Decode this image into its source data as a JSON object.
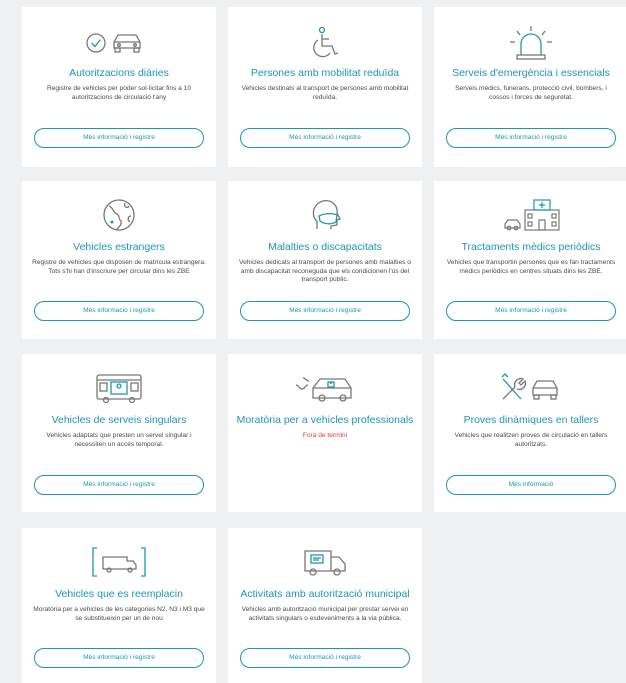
{
  "colors": {
    "accent": "#1c96b3",
    "text": "#4a4a4a",
    "alert": "#e53935",
    "background": "#eef0f2",
    "card": "#ffffff"
  },
  "cards": [
    {
      "icon": "check-car-icon",
      "title": "Autoritzacions diàries",
      "description": "Registre de vehicles per poder sol·licitar fins a 10 autoritzacions de circulació l'any",
      "button": "Més informació i registre"
    },
    {
      "icon": "wheelchair-icon",
      "title": "Persones amb mobilitat reduïda",
      "description": "Vehicles destinats al transport de persones amb mobilitat reduïda.",
      "button": "Més informació i registre"
    },
    {
      "icon": "emergency-siren-icon",
      "title": "Serveis d'emergència i essencials",
      "description": "Serveis mèdics, funeraris, protecció civil, bombers, i cossos i forces de seguretat.",
      "button": "Més informació i registre"
    },
    {
      "icon": "globe-icon",
      "title": "Vehicles estrangers",
      "description": "Registre de vehicles que disposen de matrícula estrangera. Tots s'hi han d'inscriure per circular dins les ZBE",
      "button": "Més informació i registre"
    },
    {
      "icon": "masked-head-icon",
      "title": "Malalties o discapacitats",
      "description": "Vehicles dedicats al transport de persones amb malalties o amb discapacitat reconeguda que els condicionen l'ús del transport públic.",
      "button": "Més informació i registre"
    },
    {
      "icon": "hospital-car-icon",
      "title": "Tractaments mèdics periòdics",
      "description": "Vehicles que transportin persones que es fan tractaments mèdics periòdics en centres situats dins les ZBE.",
      "button": "Més informació i registre"
    },
    {
      "icon": "special-bus-icon",
      "title": "Vehicles de serveis singulars",
      "description": "Vehicles adaptats que presten un servei singular i necessiten un accés temporal.",
      "button": "Més informació i registre"
    },
    {
      "icon": "professional-van-icon",
      "title": "Moratòria per a vehicles professionals",
      "description": "Fora de termini",
      "button": ""
    },
    {
      "icon": "tools-car-icon",
      "title": "Proves dinàmiques en tallers",
      "description": "Vehicles que realitzen proves de circulació en tallers autoritzats.",
      "button": "Més informació"
    },
    {
      "icon": "framed-van-icon",
      "title": "Vehicles que es reemplacin",
      "description": "Moratòria per a vehicles de les categories N2, N3 i M3 que se substitueixin per un de nou",
      "button": "Més informació i registre"
    },
    {
      "icon": "municipal-van-icon",
      "title": "Activitats amb autorització municipal",
      "description": "Vehicles amb autorització municipal per prestar servei en activitats singulars o esdeveniments a la via pública.",
      "button": "Més informació i registre"
    }
  ]
}
